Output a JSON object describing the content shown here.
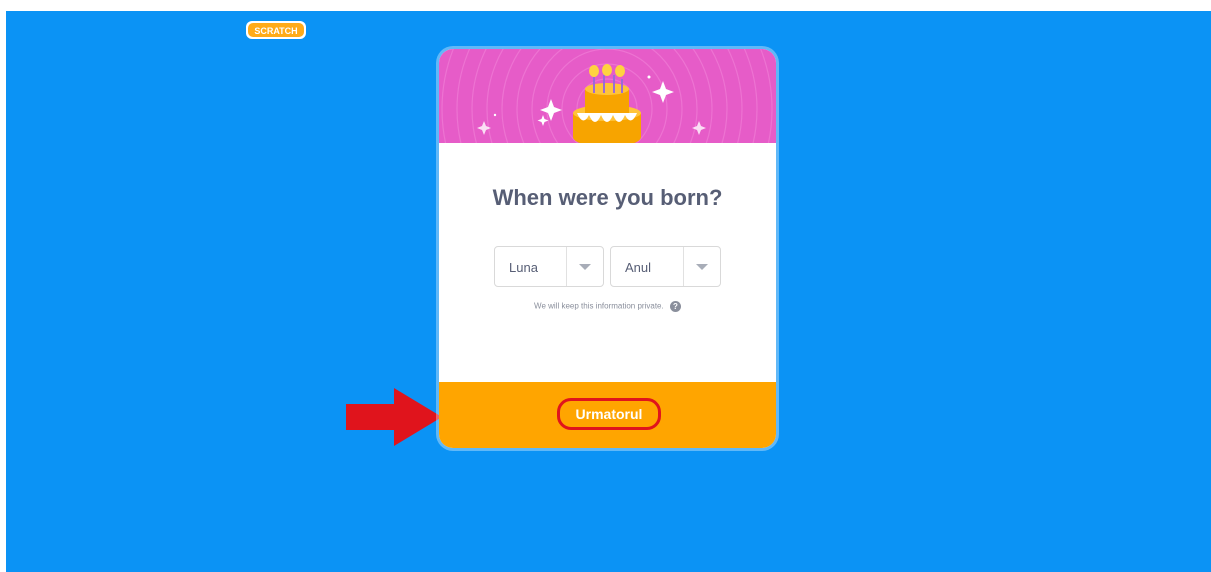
{
  "logo": {
    "text": "SCRATCH",
    "color": "#ffab19"
  },
  "dialog": {
    "title": "When were you born?",
    "month_select": {
      "selected": "Luna"
    },
    "year_select": {
      "selected": "Anul"
    },
    "privacy_note": "We will keep this information private.",
    "help_icon_glyph": "?",
    "next_button": "Urmatorul"
  },
  "colors": {
    "background": "#0b93f5",
    "banner": "#e65cc8",
    "footer": "#ffa500",
    "title": "#575e75",
    "annotation": "#e0141c"
  },
  "annotation": {
    "arrow": "red-arrow-right",
    "highlight": "next-button"
  }
}
